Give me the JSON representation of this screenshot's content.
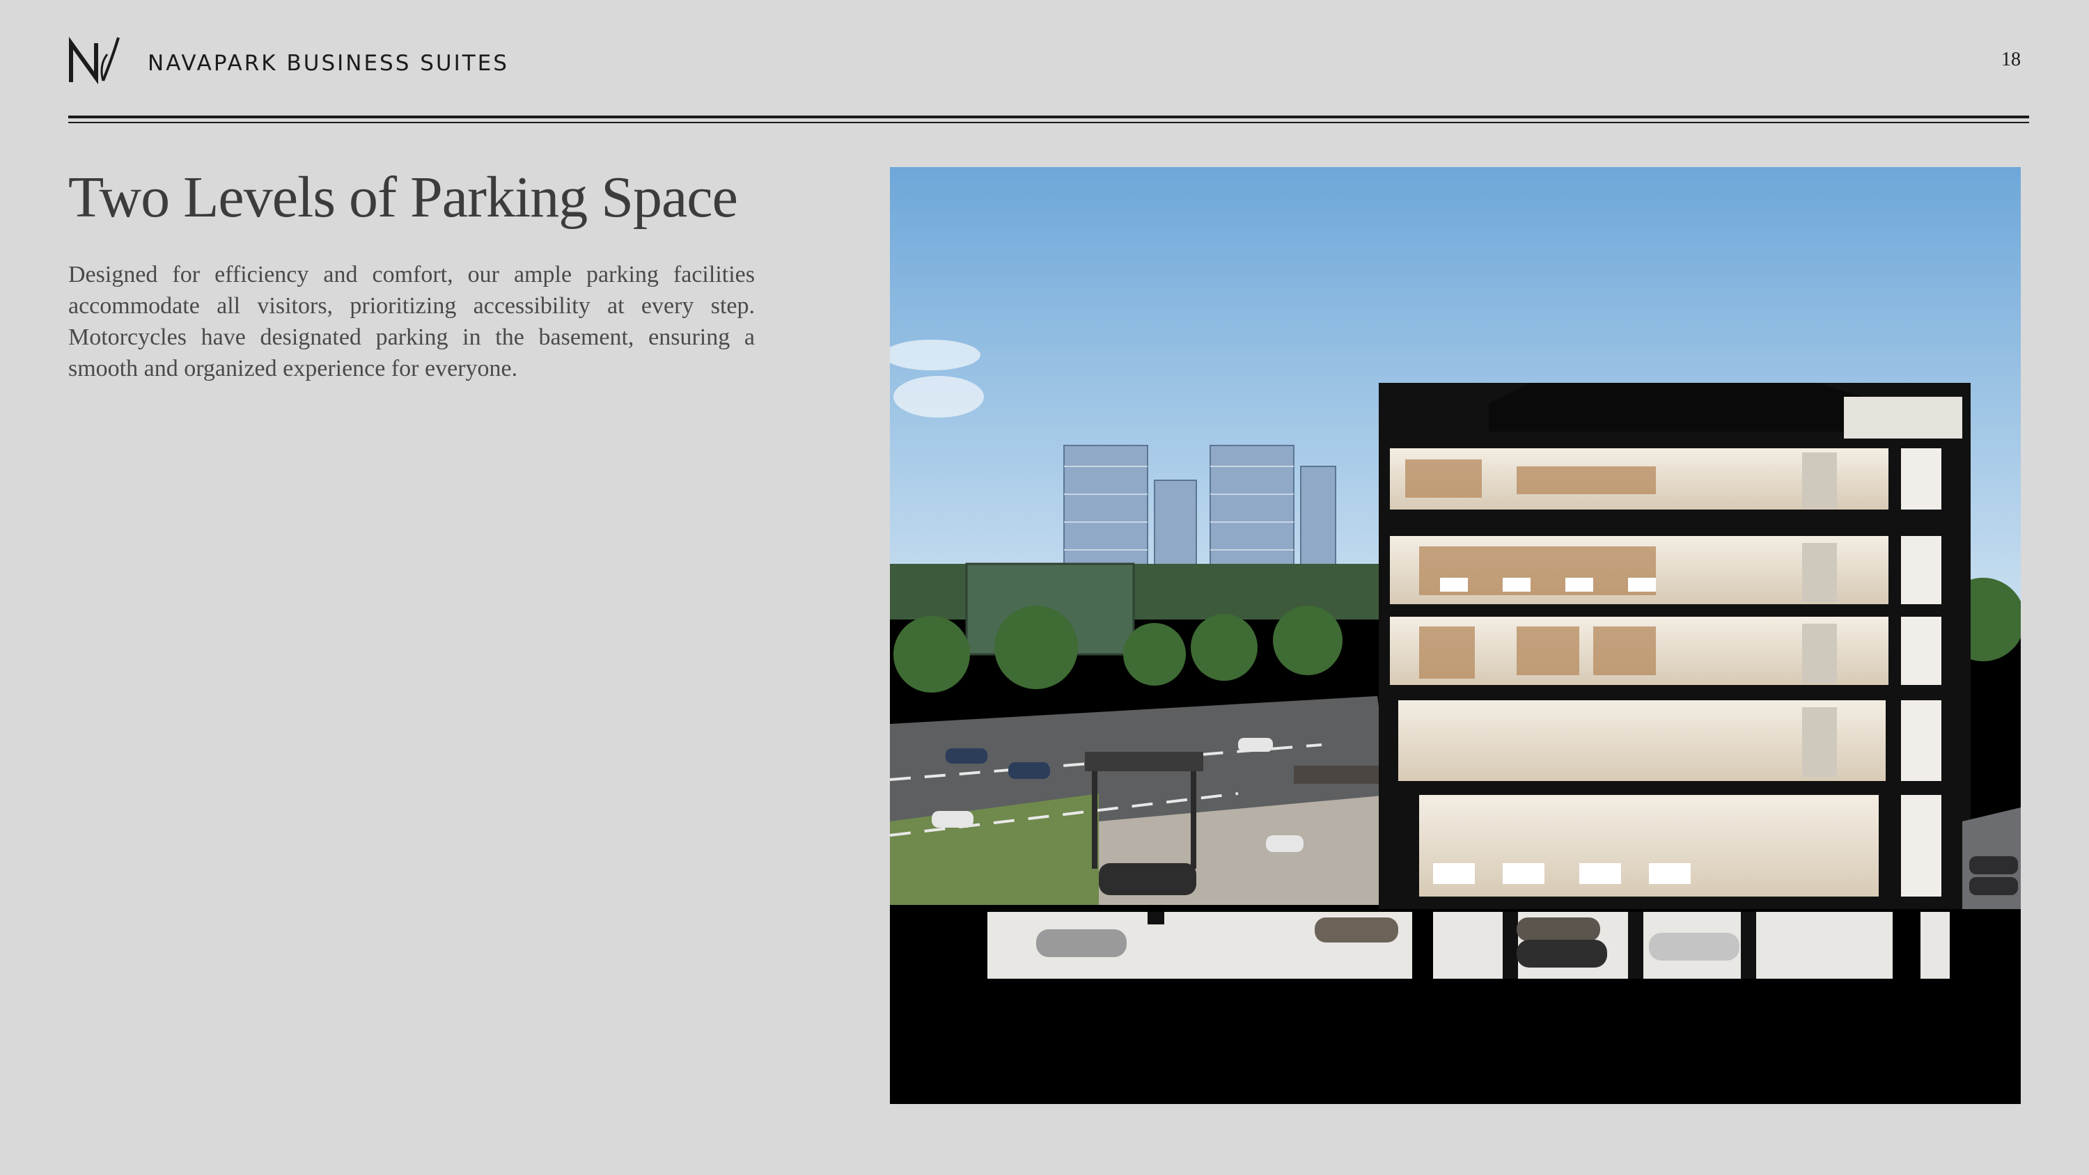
{
  "header": {
    "brand_name": "NAVAPARK BUSINESS SUITES",
    "logo_icon": "navapark-nv-logo-icon",
    "page_number": "18"
  },
  "main": {
    "title": "Two Levels of Parking Space",
    "body": "Designed for efficiency and comfort, our ample parking facilities accommodate all visitors, prioritizing accessibility at every step. Motorcycles have designated parking in the basement, ensuring a smooth and organized experience for everyone."
  },
  "image": {
    "subject": "building-cross-section-render",
    "colors": {
      "sky_top": "#6ea7d9",
      "sky_bottom": "#c9dff0",
      "interior": "#e9e1d4",
      "structure": "#111111"
    }
  }
}
